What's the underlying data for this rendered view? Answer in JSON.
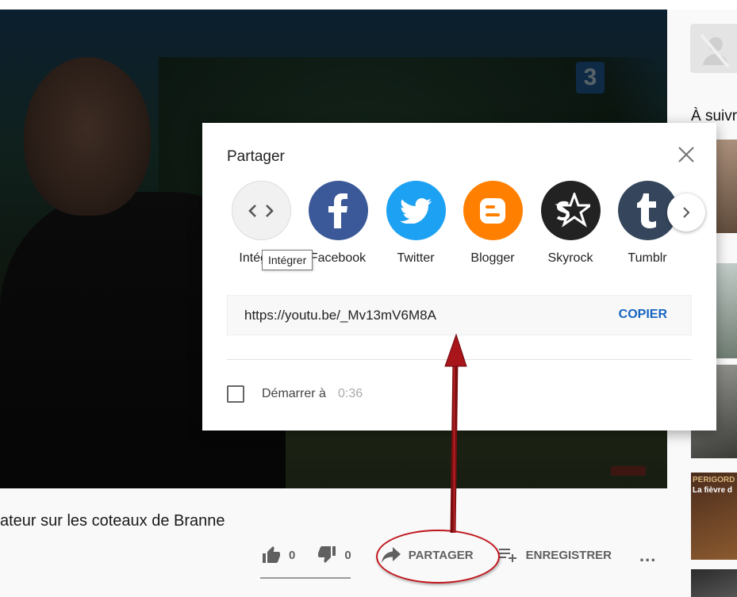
{
  "video": {
    "channel_logo": "3",
    "title_partial": "ateur sur les coteaux de Branne"
  },
  "actions": {
    "like_count": "0",
    "dislike_count": "0",
    "share_label": "PARTAGER",
    "save_label": "ENREGISTRER",
    "more_label": "..."
  },
  "sidebar": {
    "up_next_label": "À suivre",
    "thumb_caption_1": "PERIGORD",
    "thumb_caption_2": "La fièvre d"
  },
  "share_dialog": {
    "title": "Partager",
    "tooltip": "Intégrer",
    "items": [
      {
        "label": "Intégrer",
        "icon": "embed-icon",
        "color": "#f1f1f1"
      },
      {
        "label": "Facebook",
        "icon": "facebook-icon",
        "color": "#3b5998"
      },
      {
        "label": "Twitter",
        "icon": "twitter-icon",
        "color": "#1da1f2"
      },
      {
        "label": "Blogger",
        "icon": "blogger-icon",
        "color": "#ff8000"
      },
      {
        "label": "Skyrock",
        "icon": "skyrock-icon",
        "color": "#222222"
      },
      {
        "label": "Tumblr",
        "icon": "tumblr-icon",
        "color": "#35465c"
      }
    ],
    "url": "https://youtu.be/_Mv13mV6M8A",
    "copy_label": "COPIER",
    "start_at_label": "Démarrer à",
    "start_time": "0:36"
  },
  "colors": {
    "accent_blue": "#1565c0",
    "annotation_red": "#c0151b"
  }
}
